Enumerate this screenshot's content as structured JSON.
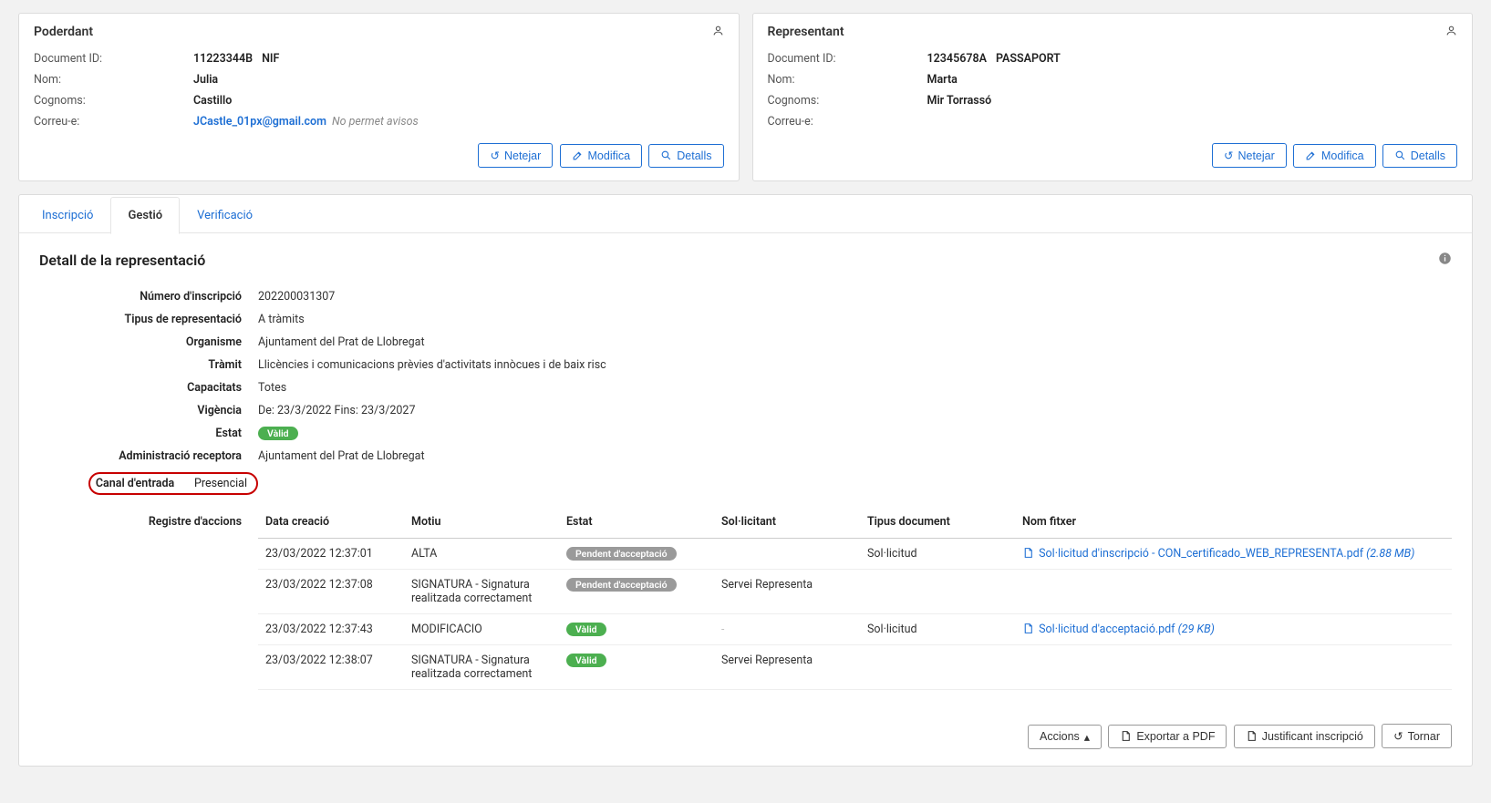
{
  "poderdant": {
    "title": "Poderdant",
    "doc_label": "Document ID:",
    "doc_id": "11223344B",
    "doc_type": "NIF",
    "nom_label": "Nom:",
    "nom": "Julia",
    "cognoms_label": "Cognoms:",
    "cognoms": "Castillo",
    "correu_label": "Correu-e:",
    "correu": "JCastle_01px@gmail.com",
    "correu_note": "No permet avisos"
  },
  "representant": {
    "title": "Representant",
    "doc_label": "Document ID:",
    "doc_id": "12345678A",
    "doc_type": "PASSAPORT",
    "nom_label": "Nom:",
    "nom": "Marta",
    "cognoms_label": "Cognoms:",
    "cognoms": "Mir Torrassó",
    "correu_label": "Correu-e:",
    "correu": ""
  },
  "card_buttons": {
    "netejar": "Netejar",
    "modifica": "Modifica",
    "detalls": "Detalls"
  },
  "tabs": {
    "inscripcio": "Inscripció",
    "gestio": "Gestió",
    "verificacio": "Verificació"
  },
  "section_title": "Detall de la representació",
  "details": {
    "num_label": "Número d'inscripció",
    "num_value": "202200031307",
    "tipus_label": "Tipus de representació",
    "tipus_value": "A tràmits",
    "org_label": "Organisme",
    "org_value": "Ajuntament del Prat de Llobregat",
    "tramit_label": "Tràmit",
    "tramit_value": "Llicències i comunicacions prèvies d'activitats innòcues i de baix risc",
    "cap_label": "Capacitats",
    "cap_value": "Totes",
    "vig_label": "Vigència",
    "vig_value": "De: 23/3/2022   Fins: 23/3/2027",
    "estat_label": "Estat",
    "estat_badge": "Vàlid",
    "adm_label": "Administració receptora",
    "adm_value": "Ajuntament del Prat de Llobregat",
    "canal_label": "Canal d'entrada",
    "canal_value": "Presencial",
    "registre_label": "Registre d'accions"
  },
  "actions_headers": {
    "data": "Data creació",
    "motiu": "Motiu",
    "estat": "Estat",
    "sol": "Sol·licitant",
    "tipus": "Tipus document",
    "fitxer": "Nom fitxer"
  },
  "actions": [
    {
      "data": "23/03/2022 12:37:01",
      "motiu": "ALTA",
      "estat": "Pendent d'acceptació",
      "estat_class": "badge-gray",
      "sol": "",
      "tipus": "Sol·licitud",
      "file": "Sol·licitud d'inscripció - CON_certificado_WEB_REPRESENTA.pdf",
      "size": "(2.88 MB)"
    },
    {
      "data": "23/03/2022 12:37:08",
      "motiu": "SIGNATURA - Signatura realitzada correctament",
      "estat": "Pendent d'acceptació",
      "estat_class": "badge-gray",
      "sol": "Servei Representa",
      "tipus": "",
      "file": "",
      "size": ""
    },
    {
      "data": "23/03/2022 12:37:43",
      "motiu": "MODIFICACIO",
      "estat": "Vàlid",
      "estat_class": "badge-green",
      "sol": "-",
      "sol_dash": true,
      "tipus": "Sol·licitud",
      "file": "Sol·licitud d'acceptació.pdf",
      "size": "(29 KB)"
    },
    {
      "data": "23/03/2022 12:38:07",
      "motiu": "SIGNATURA - Signatura realitzada correctament",
      "estat": "Vàlid",
      "estat_class": "badge-green",
      "sol": "Servei Representa",
      "tipus": "",
      "file": "",
      "size": ""
    }
  ],
  "bottom_buttons": {
    "accions": "Accions",
    "exportar": "Exportar a PDF",
    "justificant": "Justificant inscripció",
    "tornar": "Tornar"
  }
}
